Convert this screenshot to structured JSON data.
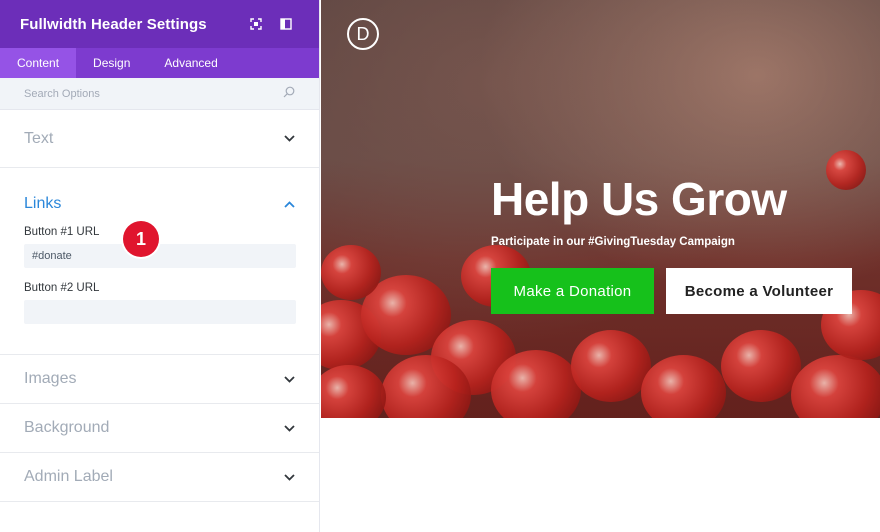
{
  "panel": {
    "title": "Fullwidth Header Settings",
    "header_icons": [
      "focus-icon",
      "sidebar-toggle-icon"
    ],
    "tabs": [
      {
        "label": "Content",
        "active": true
      },
      {
        "label": "Design",
        "active": false
      },
      {
        "label": "Advanced",
        "active": false
      }
    ],
    "search": {
      "placeholder": "Search Options",
      "value": ""
    },
    "sections": {
      "text": {
        "title": "Text",
        "expanded": false
      },
      "links": {
        "title": "Links",
        "expanded": true,
        "button1_label": "Button #1 URL",
        "button1_value": "#donate",
        "button2_label": "Button #2 URL",
        "button2_value": ""
      },
      "images": {
        "title": "Images",
        "expanded": false
      },
      "background": {
        "title": "Background",
        "expanded": false
      },
      "admin_label": {
        "title": "Admin Label",
        "expanded": false
      }
    },
    "step_badge": "1"
  },
  "preview": {
    "logo_letter": "D",
    "hero": {
      "title": "Help Us Grow",
      "subtitle": "Participate in our #GivingTuesday Campaign",
      "button_primary": "Make a Donation",
      "button_secondary": "Become a Volunteer"
    }
  },
  "colors": {
    "header_purple": "#6c2eb9",
    "tabs_purple": "#7d3bcf",
    "active_tab": "#9553e6",
    "link_blue": "#2b87da",
    "badge_red": "#e0152e",
    "donate_green": "#16c11b"
  }
}
